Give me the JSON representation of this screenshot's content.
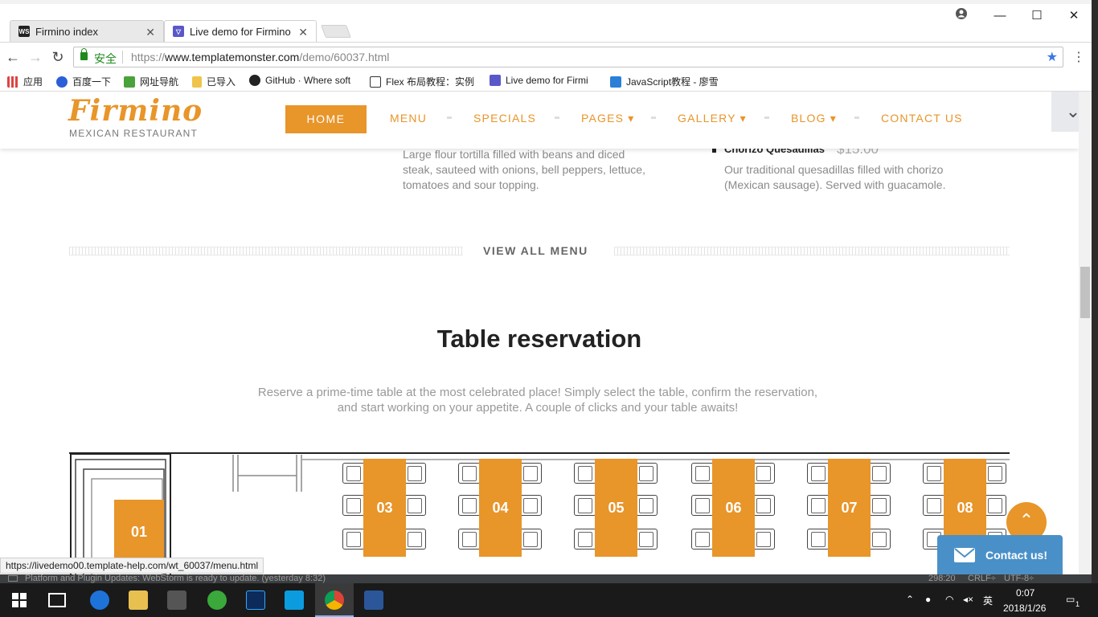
{
  "browser": {
    "tabs": [
      {
        "title": "Firmino index",
        "favicon": "WS",
        "favicon_bg": "#222"
      },
      {
        "title": "Live demo for Firmino",
        "favicon": "TM",
        "favicon_bg": "#5a58c8"
      }
    ],
    "window_controls": {
      "account": "●",
      "minimize": "—",
      "maximize": "☐",
      "close": "✕"
    },
    "secure_label": "安全",
    "url_protocol": "https://",
    "url_host": "www.templatemonster.com",
    "url_path": "/demo/60037.html",
    "bookmarks": [
      {
        "label": "应用",
        "icon_color": "#d44"
      },
      {
        "label": "百度一下",
        "icon_color": "#2a5fd8"
      },
      {
        "label": "网址导航",
        "icon_color": "#4aa23a"
      },
      {
        "label": "已导入",
        "icon_color": "#f0c44a"
      },
      {
        "label": "GitHub · Where soft",
        "icon_color": "#222"
      },
      {
        "label": "Flex 布局教程：实例",
        "icon_color": "#333"
      },
      {
        "label": "Live demo for Firmi",
        "icon_color": "#5a58c8"
      },
      {
        "label": "JavaScript教程 - 廖雪",
        "icon_color": "#2a7fd8"
      }
    ],
    "status_link": "https://livedemo00.template-help.com/wt_60037/menu.html"
  },
  "site": {
    "logo": "Firmino",
    "logo_sub": "MEXICAN RESTAURANT",
    "nav": {
      "home": "HOME",
      "menu": "MENU",
      "specials": "SPECIALS",
      "pages": "PAGES ▾",
      "gallery": "GALLERY ▾",
      "blog": "BLOG ▾",
      "contact": "CONTACT US"
    },
    "menu_items": {
      "left_desc": [
        "Large flour tortilla filled with beans and diced",
        "steak, sauteed with onions, bell peppers, lettuce,",
        "tomatoes and sour topping."
      ],
      "right_name": "Chorizo Quesadillas",
      "right_price": "$15.00",
      "right_desc": [
        "Our traditional quesadillas filled with chorizo",
        "(Mexican sausage). Served with guacamole."
      ]
    },
    "view_all": "VIEW ALL MENU",
    "reservation": {
      "title": "Table reservation",
      "desc_line1": "Reserve a prime-time table at the most celebrated place! Simply select the table, confirm the reservation,",
      "desc_line2": "and start working on your appetite. A couple of clicks and your table awaits!",
      "tables": [
        "01",
        "03",
        "04",
        "05",
        "06",
        "07",
        "08"
      ]
    },
    "contact_widget": "Contact us!",
    "scroll_top": "⌃"
  },
  "ide_status": {
    "message": "Platform and Plugin Updates: WebStorm is ready to update. (yesterday 8:32)",
    "position": "298:20",
    "line_sep": "CRLF÷",
    "encoding": "UTF-8÷"
  },
  "taskbar": {
    "time": "0:07",
    "date": "2018/1/26",
    "ime": "英",
    "notifications": "1"
  },
  "colors": {
    "accent": "#e8952a",
    "secure_green": "#1e8a1e",
    "widget_blue": "#4a90c8"
  }
}
